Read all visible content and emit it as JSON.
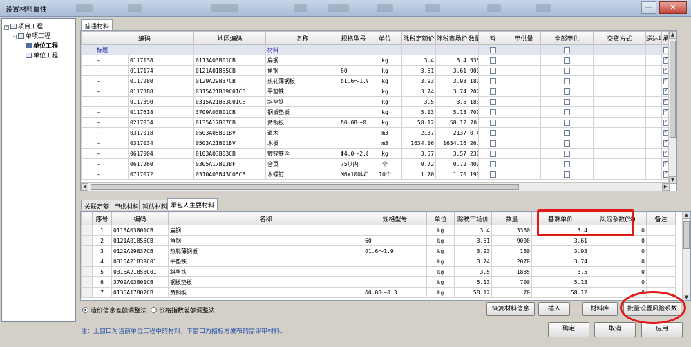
{
  "window": {
    "title": "设置材料属性",
    "close_glyph": "✕",
    "min_glyph": "—",
    "max_glyph": "□"
  },
  "tree": {
    "items": [
      {
        "label": "项目工程",
        "expand": "-"
      },
      {
        "label": "单项工程",
        "expand": "-"
      },
      {
        "label": "单位工程"
      },
      {
        "label": "单位工程"
      }
    ]
  },
  "top_tab": "普通材料",
  "top_grid": {
    "headers": [
      "编码",
      "地区编码",
      "名称",
      "规格型号",
      "单位",
      "除税定额价",
      "除税市场价",
      "数量",
      "暂",
      "甲供量",
      "全部甲供",
      "交货方式",
      "送达地点",
      "承",
      "暂"
    ],
    "group_row": {
      "code": "标题",
      "name": "材料"
    },
    "rows": [
      {
        "code": "0117138",
        "area": "0113A03B01CB",
        "name": "扁钢",
        "spec": "",
        "unit": "kg",
        "price": "3.4",
        "market": "3.4",
        "qty": "3350"
      },
      {
        "code": "0117174",
        "area": "0121A01B55CB",
        "name": "角钢",
        "spec": "60",
        "unit": "kg",
        "price": "3.61",
        "market": "3.61",
        "qty": "9000"
      },
      {
        "code": "0117280",
        "area": "0129A29B37CB",
        "name": "热轧薄钢板",
        "spec": "δ1.6～1.9",
        "unit": "kg",
        "price": "3.93",
        "market": "3.93",
        "qty": "180"
      },
      {
        "code": "0117388",
        "area": "0315A21B39C01CB",
        "name": "平垫铁",
        "spec": "",
        "unit": "kg",
        "price": "3.74",
        "market": "3.74",
        "qty": "2070"
      },
      {
        "code": "0117390",
        "area": "0315A21B53C01CB",
        "name": "斜垫铁",
        "spec": "",
        "unit": "kg",
        "price": "3.5",
        "market": "3.5",
        "qty": "1835"
      },
      {
        "code": "0117618",
        "area": "3709A03B01CB",
        "name": "钢板垫板",
        "spec": "",
        "unit": "kg",
        "price": "5.13",
        "market": "5.13",
        "qty": "700"
      },
      {
        "code": "0217034",
        "area": "0135A17B07CB",
        "name": "黄铜板",
        "spec": "δ0.08～0.3",
        "unit": "kg",
        "price": "58.12",
        "market": "58.12",
        "qty": "70"
      },
      {
        "code": "0317018",
        "area": "0503A05B01BV",
        "name": "道木",
        "spec": "",
        "unit": "m3",
        "price": "2137",
        "market": "2137",
        "qty": "0.4"
      },
      {
        "code": "0317034",
        "area": "0503A21B01BV",
        "name": "木板",
        "spec": "",
        "unit": "m3",
        "price": "1634.16",
        "market": "1634.16",
        "qty": "26.1"
      },
      {
        "code": "0617004",
        "area": "0103A03B03CB",
        "name": "镀锌铁丝",
        "spec": "Φ4.0～2.8",
        "unit": "kg",
        "price": "3.57",
        "market": "3.57",
        "qty": "236"
      },
      {
        "code": "0617260",
        "area": "0305A17B03BF",
        "name": "合页",
        "spec": "75以内",
        "unit": "个",
        "price": "0.72",
        "market": "0.72",
        "qty": "400"
      },
      {
        "code": "0717072",
        "area": "0310A03B43C05CB",
        "name": "木螺钉",
        "spec": "M6×100以下",
        "unit": "10个",
        "price": "1.70",
        "market": "1.70",
        "qty": "190"
      }
    ]
  },
  "bottom_tabs": [
    "关联定额",
    "甲供材料",
    "暂估材料",
    "承包人主要材料"
  ],
  "bottom_grid": {
    "headers": [
      "序号",
      "编码",
      "名称",
      "规格型号",
      "单位",
      "除税市场价",
      "数量",
      "基准单价",
      "风险系数(%)",
      "备注"
    ],
    "rows": [
      {
        "no": "1",
        "code": "0113A03B01CB",
        "name": "扁钢",
        "spec": "",
        "unit": "kg",
        "market": "3.4",
        "qty": "3350",
        "base": "3.4",
        "risk": "0"
      },
      {
        "no": "2",
        "code": "0121A01B55CB",
        "name": "角钢",
        "spec": "60",
        "unit": "kg",
        "market": "3.61",
        "qty": "9000",
        "base": "3.61",
        "risk": "0"
      },
      {
        "no": "3",
        "code": "0129A29B37CB",
        "name": "热轧薄钢板",
        "spec": "δ1.6～1.9",
        "unit": "kg",
        "market": "3.93",
        "qty": "180",
        "base": "3.93",
        "risk": "0"
      },
      {
        "no": "4",
        "code": "0315A21B39C01",
        "name": "平垫铁",
        "spec": "",
        "unit": "kg",
        "market": "3.74",
        "qty": "2070",
        "base": "3.74",
        "risk": "0"
      },
      {
        "no": "5",
        "code": "0315A21B53C01",
        "name": "斜垫铁",
        "spec": "",
        "unit": "kg",
        "market": "3.5",
        "qty": "1835",
        "base": "3.5",
        "risk": "0"
      },
      {
        "no": "6",
        "code": "3709A03B01CB",
        "name": "钢板垫板",
        "spec": "",
        "unit": "kg",
        "market": "5.13",
        "qty": "700",
        "base": "5.13",
        "risk": "0"
      },
      {
        "no": "7",
        "code": "0135A17B07CB",
        "name": "黄铜板",
        "spec": "δ0.08～0.3",
        "unit": "kg",
        "market": "58.12",
        "qty": "70",
        "base": "58.12",
        "risk": "0"
      }
    ]
  },
  "radios": {
    "opt1": "造价信息差额调整法",
    "opt2": "价格指数差额调整法"
  },
  "buttons": {
    "restore": "恢复材料信息",
    "insert": "插入",
    "library": "材料库",
    "batch_risk": "批量设置风险系数",
    "ok": "确定",
    "cancel": "取消",
    "apply": "应用"
  },
  "note": "注：上窗口为当前单位工程中的材料，下窗口为招标方发布的需评审材料。",
  "accent": {
    "highlight": "#e01818",
    "note_text": "#1f4ea8"
  }
}
